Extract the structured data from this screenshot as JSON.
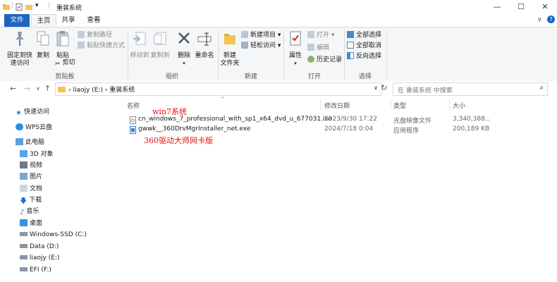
{
  "window": {
    "title": "重装系统",
    "controls": {
      "minimize": "—",
      "maximize": "☐",
      "close": "✕"
    }
  },
  "ribbon_tabs": [
    {
      "label": "文件"
    },
    {
      "label": "主页"
    },
    {
      "label": "共享"
    },
    {
      "label": "查看"
    }
  ],
  "ribbon": {
    "clipboard": {
      "label": "剪贴板",
      "pin_line1": "固定到快",
      "pin_line2": "速访问",
      "copy": "复制",
      "paste": "粘贴",
      "copy_path": "复制路径",
      "paste_shortcut": "粘贴快捷方式",
      "cut": "剪切"
    },
    "organize": {
      "label": "组织",
      "move_to": "移动到",
      "copy_to": "复制到",
      "delete": "删除",
      "rename": "重命名"
    },
    "new": {
      "label": "新建",
      "new_folder_line1": "新建",
      "new_folder_line2": "文件夹",
      "new_item": "新建项目",
      "easy_access": "轻松访问"
    },
    "open": {
      "label": "打开",
      "properties": "属性",
      "open": "打开",
      "edit": "编辑",
      "history": "历史记录"
    },
    "select": {
      "label": "选择",
      "select_all": "全部选择",
      "select_none": "全部取消",
      "invert": "反向选择"
    }
  },
  "address": {
    "path": [
      "liaojy (E:)",
      "重装系统"
    ],
    "search_placeholder": "在 重装系统 中搜索"
  },
  "nav_pane": [
    {
      "label": "快速访问",
      "icon": "star-icon"
    },
    {
      "label": "WPS云盘",
      "icon": "cloud-icon"
    },
    {
      "label": "此电脑",
      "icon": "pc-icon"
    },
    {
      "label": "3D 对象",
      "icon": "cube-icon"
    },
    {
      "label": "视频",
      "icon": "video-icon"
    },
    {
      "label": "图片",
      "icon": "picture-icon"
    },
    {
      "label": "文档",
      "icon": "document-icon"
    },
    {
      "label": "下载",
      "icon": "download-icon"
    },
    {
      "label": "音乐",
      "icon": "music-icon"
    },
    {
      "label": "桌面",
      "icon": "desktop-icon"
    },
    {
      "label": "Windows-SSD (C:)",
      "icon": "drive-icon"
    },
    {
      "label": "Data (D:)",
      "icon": "drive-icon"
    },
    {
      "label": "liaojy (E:)",
      "icon": "drive-icon"
    },
    {
      "label": "EFI (F:)",
      "icon": "drive-icon"
    }
  ],
  "file_list": {
    "columns": [
      "名称",
      "修改日期",
      "类型",
      "大小"
    ],
    "rows": [
      {
        "name": "cn_windows_7_professional_with_sp1_x64_dvd_u_677031.iso",
        "modified": "2023/9/30 17:22",
        "type": "光盘映像文件",
        "size": "3,340,388..."
      },
      {
        "name": "gwwk__360DrvMgrInstaller_net.exe",
        "modified": "2024/7/18 0:04",
        "type": "应用程序",
        "size": "200,189 KB"
      }
    ]
  },
  "annotations": {
    "win7": "win7系统",
    "driver": "360驱动大师网卡版"
  },
  "colors": {
    "accent": "#1c65c0",
    "annotation": "#e11414",
    "folder": "#f3c44f"
  }
}
